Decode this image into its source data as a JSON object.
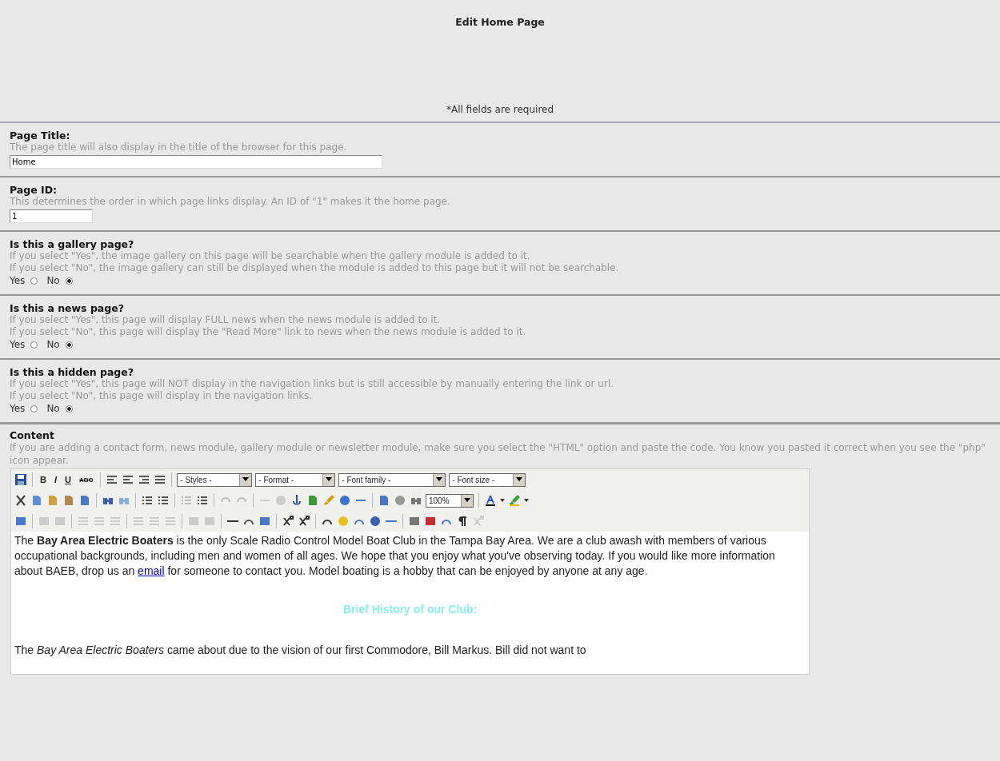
{
  "header": {
    "title": "Edit Home Page",
    "note": "*All fields are required"
  },
  "fields": [
    {
      "kind": "text",
      "label": "Page Title:",
      "descriptions": [
        "The page title will also display in the title of the browser for this page."
      ],
      "value": "Home"
    },
    {
      "kind": "text",
      "label": "Page ID:",
      "descriptions": [
        "This determines the order in which page links display. An ID of \"1\" makes it the home page."
      ],
      "value": "1"
    },
    {
      "kind": "radio",
      "label": "Is this a gallery page?",
      "descriptions": [
        "If you select \"Yes\", the image gallery on this page will be searchable when the gallery module is added to it.",
        "If you select \"No\", the image gallery can still be displayed when the module is added to this page but it will not be searchable."
      ],
      "options": [
        {
          "label": "Yes",
          "selected": false
        },
        {
          "label": "No",
          "selected": true
        }
      ]
    },
    {
      "kind": "radio",
      "label": "Is this a news page?",
      "descriptions": [
        "If you select \"Yes\", this page will display FULL news when the news module is added to it.",
        "If you select \"No\", this page will display the \"Read More\" link to news when the news module is added to it."
      ],
      "options": [
        {
          "label": "Yes",
          "selected": false
        },
        {
          "label": "No",
          "selected": true
        }
      ]
    },
    {
      "kind": "radio",
      "label": "Is this a hidden page?",
      "descriptions": [
        "If you select \"Yes\", this page will NOT display in the navigation links but is still accessible by manually entering the link or url.",
        "If you select \"No\", this page will display in the navigation links."
      ],
      "options": [
        {
          "label": "Yes",
          "selected": false
        },
        {
          "label": "No",
          "selected": true
        }
      ]
    }
  ],
  "content": {
    "label": "Content",
    "description": "If you are adding a contact form, news module, gallery module or newsletter module, make sure you select the \"HTML\" option and paste the code. You know you pasted it correct when you see the \"php\" icon appear.",
    "toolbar": {
      "format_buttons": [
        "B",
        "I",
        "U",
        "ABC"
      ],
      "selects": [
        "- Styles -",
        "- Format -",
        "- Font family -",
        "- Font size -"
      ],
      "zoom": "100%"
    },
    "body": {
      "intro_before": "The **Bay Area Electric Boaters** is the only Scale Radio Control Model Boat Club in the Tampa Bay Area. We are a club awash with members of various occupational backgrounds, including men and women of all ages. We hope that you enjoy what you've observing today. If you would like more information about BAEB, drop us an",
      "link": "email",
      "intro_after": "for someone to contact you. Model boating is a hobby that can be enjoyed by anyone at any age.",
      "heading": "Brief History of our Club:",
      "paragraph": "The *Bay Area Electric Boaters* came about due to the vision of our first Commodore, Bill Markus. Bill did not want to"
    }
  }
}
